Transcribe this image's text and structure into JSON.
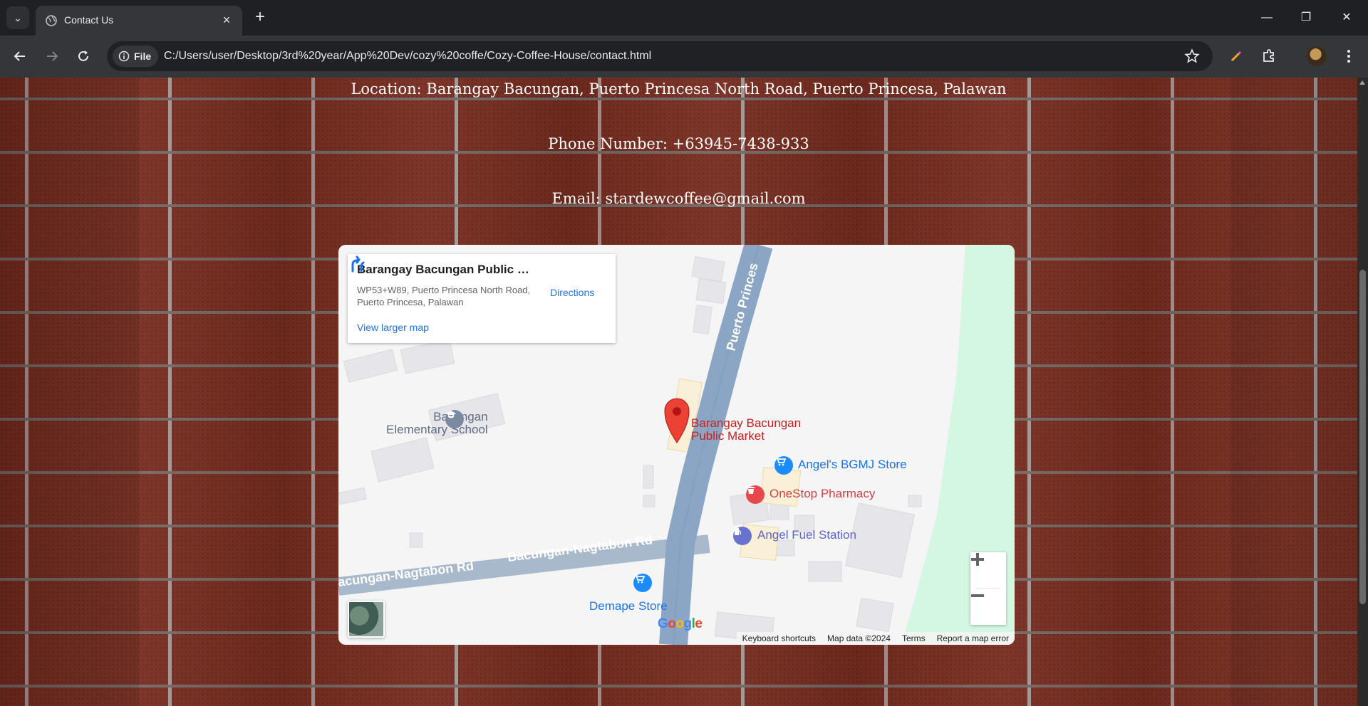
{
  "browser": {
    "tab_title": "Contact Us",
    "file_chip": "File",
    "url": "C:/Users/user/Desktop/3rd%20year/App%20Dev/cozy%20coffe/Cozy-Coffee-House/contact.html"
  },
  "contact": {
    "location": "Location: Barangay Bacungan, Puerto Princesa North Road, Puerto Princesa, Palawan",
    "phone": "Phone Number: +63945-7438-933",
    "email": "Email: stardewcoffee@gmail.com"
  },
  "map": {
    "place_title": "Barangay Bacungan Public M...",
    "place_address": "WP53+W89, Puerto Princesa North Road, Puerto Princesa, Palawan",
    "view_larger": "View larger map",
    "directions": "Directions",
    "labels": {
      "road_north": "Puerto Princes",
      "road_west_1": "Bacungan-Nagtabon Rd",
      "road_west_2": "acungan-Nagtabon Rd",
      "school_line1": "Bacungan",
      "school_line2": "Elementary School",
      "market_line1": "Barangay Bacungan",
      "market_line2": "Public Market",
      "store_1": "Angel's BGMJ Store",
      "pharmacy": "OneStop Pharmacy",
      "fuel": "Angel Fuel Station",
      "store_2": "Demape Store"
    },
    "logo": "Google",
    "footer": {
      "shortcuts": "Keyboard shortcuts",
      "map_data": "Map data ©2024",
      "terms": "Terms",
      "report": "Report a map error"
    },
    "colors": {
      "road": "#8ba6c4",
      "park": "#d4f7e1",
      "pin": "#ea4335",
      "shop": "#1a8cff",
      "pharmacy": "#e8474b",
      "fuel": "#6a72d0"
    }
  }
}
